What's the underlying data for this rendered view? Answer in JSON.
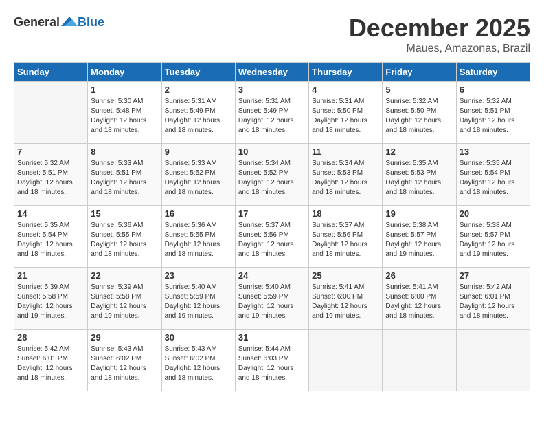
{
  "header": {
    "logo_general": "General",
    "logo_blue": "Blue",
    "month": "December 2025",
    "location": "Maues, Amazonas, Brazil"
  },
  "weekdays": [
    "Sunday",
    "Monday",
    "Tuesday",
    "Wednesday",
    "Thursday",
    "Friday",
    "Saturday"
  ],
  "weeks": [
    [
      {
        "day": "",
        "sunrise": "",
        "sunset": "",
        "daylight": ""
      },
      {
        "day": "1",
        "sunrise": "Sunrise: 5:30 AM",
        "sunset": "Sunset: 5:48 PM",
        "daylight": "Daylight: 12 hours and 18 minutes."
      },
      {
        "day": "2",
        "sunrise": "Sunrise: 5:31 AM",
        "sunset": "Sunset: 5:49 PM",
        "daylight": "Daylight: 12 hours and 18 minutes."
      },
      {
        "day": "3",
        "sunrise": "Sunrise: 5:31 AM",
        "sunset": "Sunset: 5:49 PM",
        "daylight": "Daylight: 12 hours and 18 minutes."
      },
      {
        "day": "4",
        "sunrise": "Sunrise: 5:31 AM",
        "sunset": "Sunset: 5:50 PM",
        "daylight": "Daylight: 12 hours and 18 minutes."
      },
      {
        "day": "5",
        "sunrise": "Sunrise: 5:32 AM",
        "sunset": "Sunset: 5:50 PM",
        "daylight": "Daylight: 12 hours and 18 minutes."
      },
      {
        "day": "6",
        "sunrise": "Sunrise: 5:32 AM",
        "sunset": "Sunset: 5:51 PM",
        "daylight": "Daylight: 12 hours and 18 minutes."
      }
    ],
    [
      {
        "day": "7",
        "sunrise": "Sunrise: 5:32 AM",
        "sunset": "Sunset: 5:51 PM",
        "daylight": "Daylight: 12 hours and 18 minutes."
      },
      {
        "day": "8",
        "sunrise": "Sunrise: 5:33 AM",
        "sunset": "Sunset: 5:51 PM",
        "daylight": "Daylight: 12 hours and 18 minutes."
      },
      {
        "day": "9",
        "sunrise": "Sunrise: 5:33 AM",
        "sunset": "Sunset: 5:52 PM",
        "daylight": "Daylight: 12 hours and 18 minutes."
      },
      {
        "day": "10",
        "sunrise": "Sunrise: 5:34 AM",
        "sunset": "Sunset: 5:52 PM",
        "daylight": "Daylight: 12 hours and 18 minutes."
      },
      {
        "day": "11",
        "sunrise": "Sunrise: 5:34 AM",
        "sunset": "Sunset: 5:53 PM",
        "daylight": "Daylight: 12 hours and 18 minutes."
      },
      {
        "day": "12",
        "sunrise": "Sunrise: 5:35 AM",
        "sunset": "Sunset: 5:53 PM",
        "daylight": "Daylight: 12 hours and 18 minutes."
      },
      {
        "day": "13",
        "sunrise": "Sunrise: 5:35 AM",
        "sunset": "Sunset: 5:54 PM",
        "daylight": "Daylight: 12 hours and 18 minutes."
      }
    ],
    [
      {
        "day": "14",
        "sunrise": "Sunrise: 5:35 AM",
        "sunset": "Sunset: 5:54 PM",
        "daylight": "Daylight: 12 hours and 18 minutes."
      },
      {
        "day": "15",
        "sunrise": "Sunrise: 5:36 AM",
        "sunset": "Sunset: 5:55 PM",
        "daylight": "Daylight: 12 hours and 18 minutes."
      },
      {
        "day": "16",
        "sunrise": "Sunrise: 5:36 AM",
        "sunset": "Sunset: 5:55 PM",
        "daylight": "Daylight: 12 hours and 18 minutes."
      },
      {
        "day": "17",
        "sunrise": "Sunrise: 5:37 AM",
        "sunset": "Sunset: 5:56 PM",
        "daylight": "Daylight: 12 hours and 18 minutes."
      },
      {
        "day": "18",
        "sunrise": "Sunrise: 5:37 AM",
        "sunset": "Sunset: 5:56 PM",
        "daylight": "Daylight: 12 hours and 18 minutes."
      },
      {
        "day": "19",
        "sunrise": "Sunrise: 5:38 AM",
        "sunset": "Sunset: 5:57 PM",
        "daylight": "Daylight: 12 hours and 19 minutes."
      },
      {
        "day": "20",
        "sunrise": "Sunrise: 5:38 AM",
        "sunset": "Sunset: 5:57 PM",
        "daylight": "Daylight: 12 hours and 19 minutes."
      }
    ],
    [
      {
        "day": "21",
        "sunrise": "Sunrise: 5:39 AM",
        "sunset": "Sunset: 5:58 PM",
        "daylight": "Daylight: 12 hours and 19 minutes."
      },
      {
        "day": "22",
        "sunrise": "Sunrise: 5:39 AM",
        "sunset": "Sunset: 5:58 PM",
        "daylight": "Daylight: 12 hours and 19 minutes."
      },
      {
        "day": "23",
        "sunrise": "Sunrise: 5:40 AM",
        "sunset": "Sunset: 5:59 PM",
        "daylight": "Daylight: 12 hours and 19 minutes."
      },
      {
        "day": "24",
        "sunrise": "Sunrise: 5:40 AM",
        "sunset": "Sunset: 5:59 PM",
        "daylight": "Daylight: 12 hours and 19 minutes."
      },
      {
        "day": "25",
        "sunrise": "Sunrise: 5:41 AM",
        "sunset": "Sunset: 6:00 PM",
        "daylight": "Daylight: 12 hours and 19 minutes."
      },
      {
        "day": "26",
        "sunrise": "Sunrise: 5:41 AM",
        "sunset": "Sunset: 6:00 PM",
        "daylight": "Daylight: 12 hours and 18 minutes."
      },
      {
        "day": "27",
        "sunrise": "Sunrise: 5:42 AM",
        "sunset": "Sunset: 6:01 PM",
        "daylight": "Daylight: 12 hours and 18 minutes."
      }
    ],
    [
      {
        "day": "28",
        "sunrise": "Sunrise: 5:42 AM",
        "sunset": "Sunset: 6:01 PM",
        "daylight": "Daylight: 12 hours and 18 minutes."
      },
      {
        "day": "29",
        "sunrise": "Sunrise: 5:43 AM",
        "sunset": "Sunset: 6:02 PM",
        "daylight": "Daylight: 12 hours and 18 minutes."
      },
      {
        "day": "30",
        "sunrise": "Sunrise: 5:43 AM",
        "sunset": "Sunset: 6:02 PM",
        "daylight": "Daylight: 12 hours and 18 minutes."
      },
      {
        "day": "31",
        "sunrise": "Sunrise: 5:44 AM",
        "sunset": "Sunset: 6:03 PM",
        "daylight": "Daylight: 12 hours and 18 minutes."
      },
      {
        "day": "",
        "sunrise": "",
        "sunset": "",
        "daylight": ""
      },
      {
        "day": "",
        "sunrise": "",
        "sunset": "",
        "daylight": ""
      },
      {
        "day": "",
        "sunrise": "",
        "sunset": "",
        "daylight": ""
      }
    ]
  ]
}
